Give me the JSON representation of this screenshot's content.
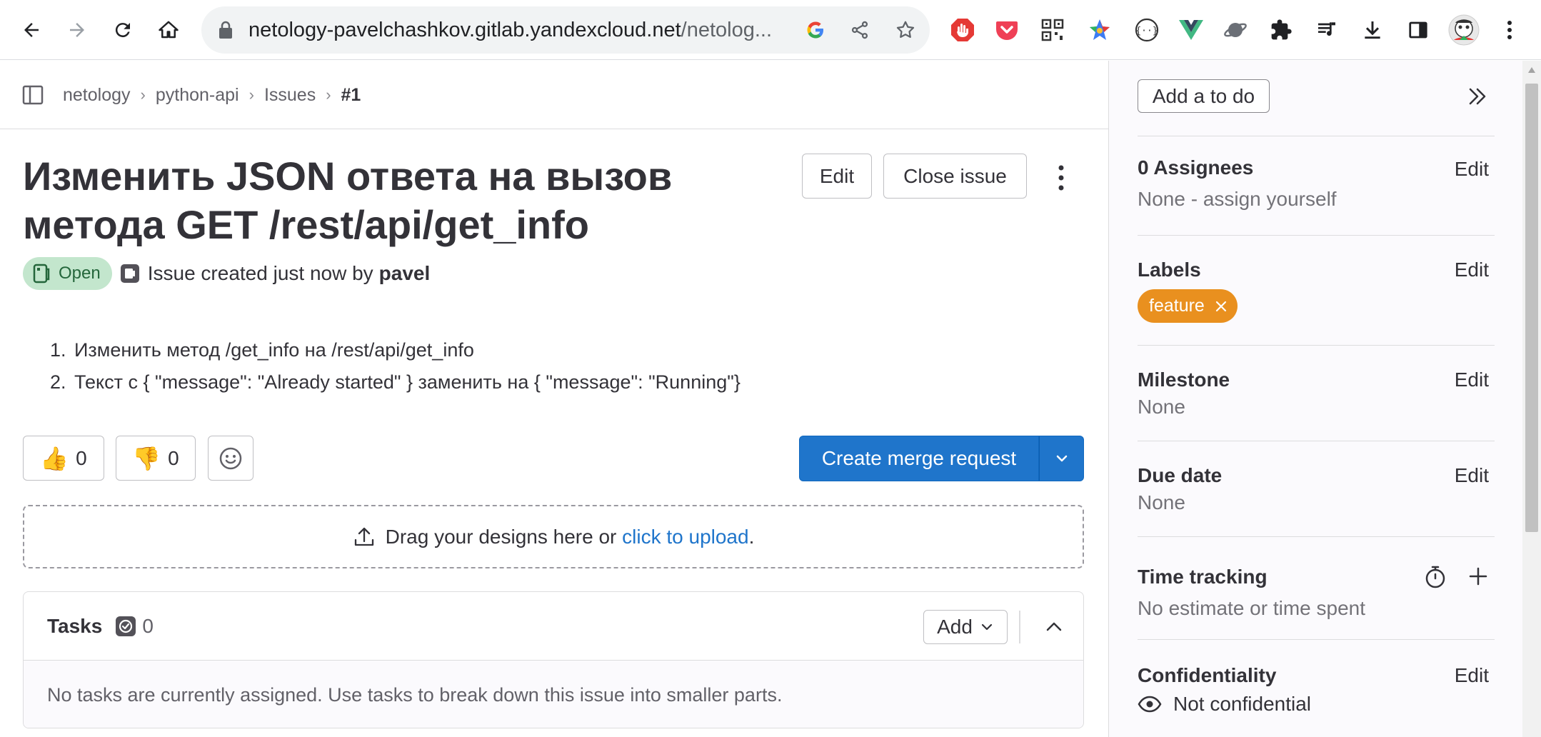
{
  "browser": {
    "url_host": "netology-pavelchashkov.gitlab.yandexcloud.net",
    "url_path": "/netolog..."
  },
  "breadcrumb": {
    "items": [
      "netology",
      "python-api",
      "Issues",
      "#1"
    ]
  },
  "issue": {
    "title": "Изменить JSON ответа на вызов метода GET /rest/api/get_info",
    "edit_label": "Edit",
    "close_label": "Close issue",
    "status": "Open",
    "created_text": "Issue created just now by",
    "author": "pavel",
    "description": [
      {
        "num": "1.",
        "text": "Изменить метод /get_info на /rest/api/get_info"
      },
      {
        "num": "2.",
        "text": "Текст с { \"message\": \"Already started\" } заменить на { \"message\": \"Running\"}"
      }
    ],
    "thumbs_up": "0",
    "thumbs_down": "0",
    "create_mr_label": "Create merge request",
    "upload_text": "Drag your designs here or",
    "upload_link": "click to upload",
    "upload_suffix": "."
  },
  "tasks": {
    "title": "Tasks",
    "count": "0",
    "add_label": "Add",
    "empty_text": "No tasks are currently assigned. Use tasks to break down this issue into smaller parts."
  },
  "sidebar": {
    "todo_label": "Add a to do",
    "edit_label": "Edit",
    "assignees": {
      "label": "0 Assignees",
      "value": "None - assign yourself"
    },
    "labels": {
      "label": "Labels",
      "tag": "feature"
    },
    "milestone": {
      "label": "Milestone",
      "value": "None"
    },
    "due_date": {
      "label": "Due date",
      "value": "None"
    },
    "time_tracking": {
      "label": "Time tracking",
      "value": "No estimate or time spent"
    },
    "confidentiality": {
      "label": "Confidentiality",
      "value": "Not confidential"
    }
  },
  "colors": {
    "primary": "#1f75cb",
    "open_badge_bg": "#c3e6cd",
    "open_badge_text": "#24663b",
    "label_feature": "#e9901f"
  },
  "icons": {
    "back": "arrow-left-icon",
    "forward": "arrow-right-icon",
    "reload": "reload-icon",
    "home": "home-icon"
  }
}
